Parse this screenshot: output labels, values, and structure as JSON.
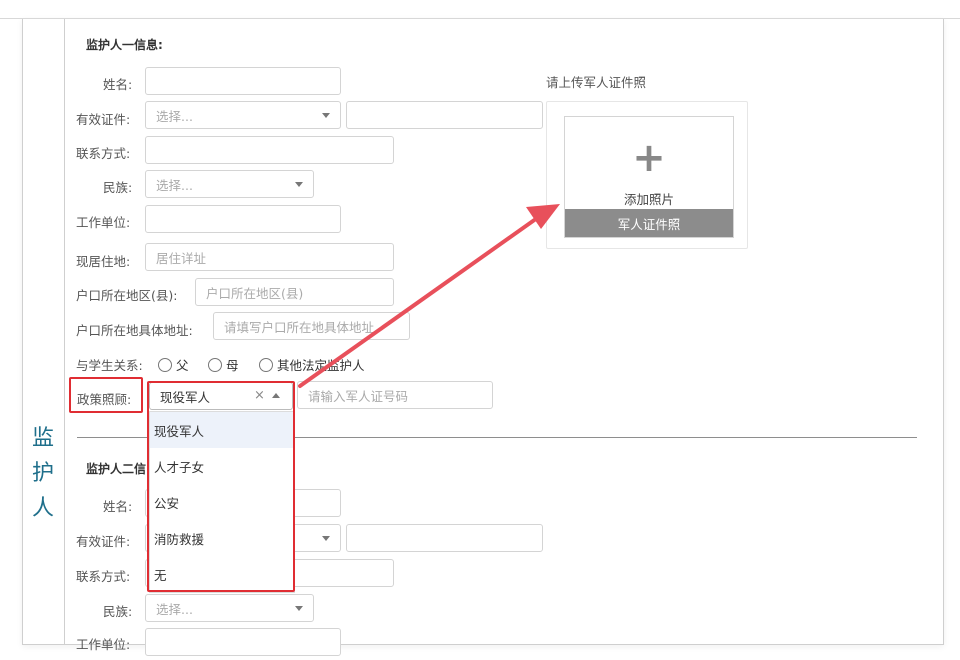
{
  "side_label_chars": [
    "监",
    "护",
    "人"
  ],
  "guardian1": {
    "title": "监护人一信息:",
    "name_label": "姓名:",
    "id_label": "有效证件:",
    "id_select_placeholder": "选择...",
    "contact_label": "联系方式:",
    "ethnicity_label": "民族:",
    "ethnicity_placeholder": "选择...",
    "work_label": "工作单位:",
    "address_label": "现居住地:",
    "address_placeholder": "居住详址",
    "hukou_region_label": "户口所在地区(县):",
    "hukou_region_placeholder": "户口所在地区(县)",
    "hukou_detail_label": "户口所在地具体地址:",
    "hukou_detail_placeholder": "请填写户口所在地具体地址",
    "relation_label": "与学生关系:",
    "relation_options": [
      "父",
      "母",
      "其他法定监护人"
    ],
    "policy_label": "政策照顾:",
    "policy_selected": "现役军人",
    "policy_clear": "×",
    "military_id_placeholder": "请输入军人证号码"
  },
  "upload": {
    "hint": "请上传军人证件照",
    "plus": "+",
    "add_photo": "添加照片",
    "caption": "军人证件照"
  },
  "policy_dropdown": {
    "options": [
      "现役军人",
      "人才子女",
      "公安",
      "消防救援",
      "无"
    ],
    "highlighted": "现役军人"
  },
  "guardian2": {
    "title_visible": "监护人二信",
    "name_label": "姓名:",
    "id_label": "有效证件:",
    "contact_label": "联系方式:",
    "ethnicity_label": "民族:",
    "ethnicity_placeholder": "选择...",
    "work_label": "工作单位:"
  },
  "colors": {
    "annotation_red": "#e02d33",
    "side_label": "#1f6f8b",
    "caption_bg": "#8c8c8c"
  }
}
